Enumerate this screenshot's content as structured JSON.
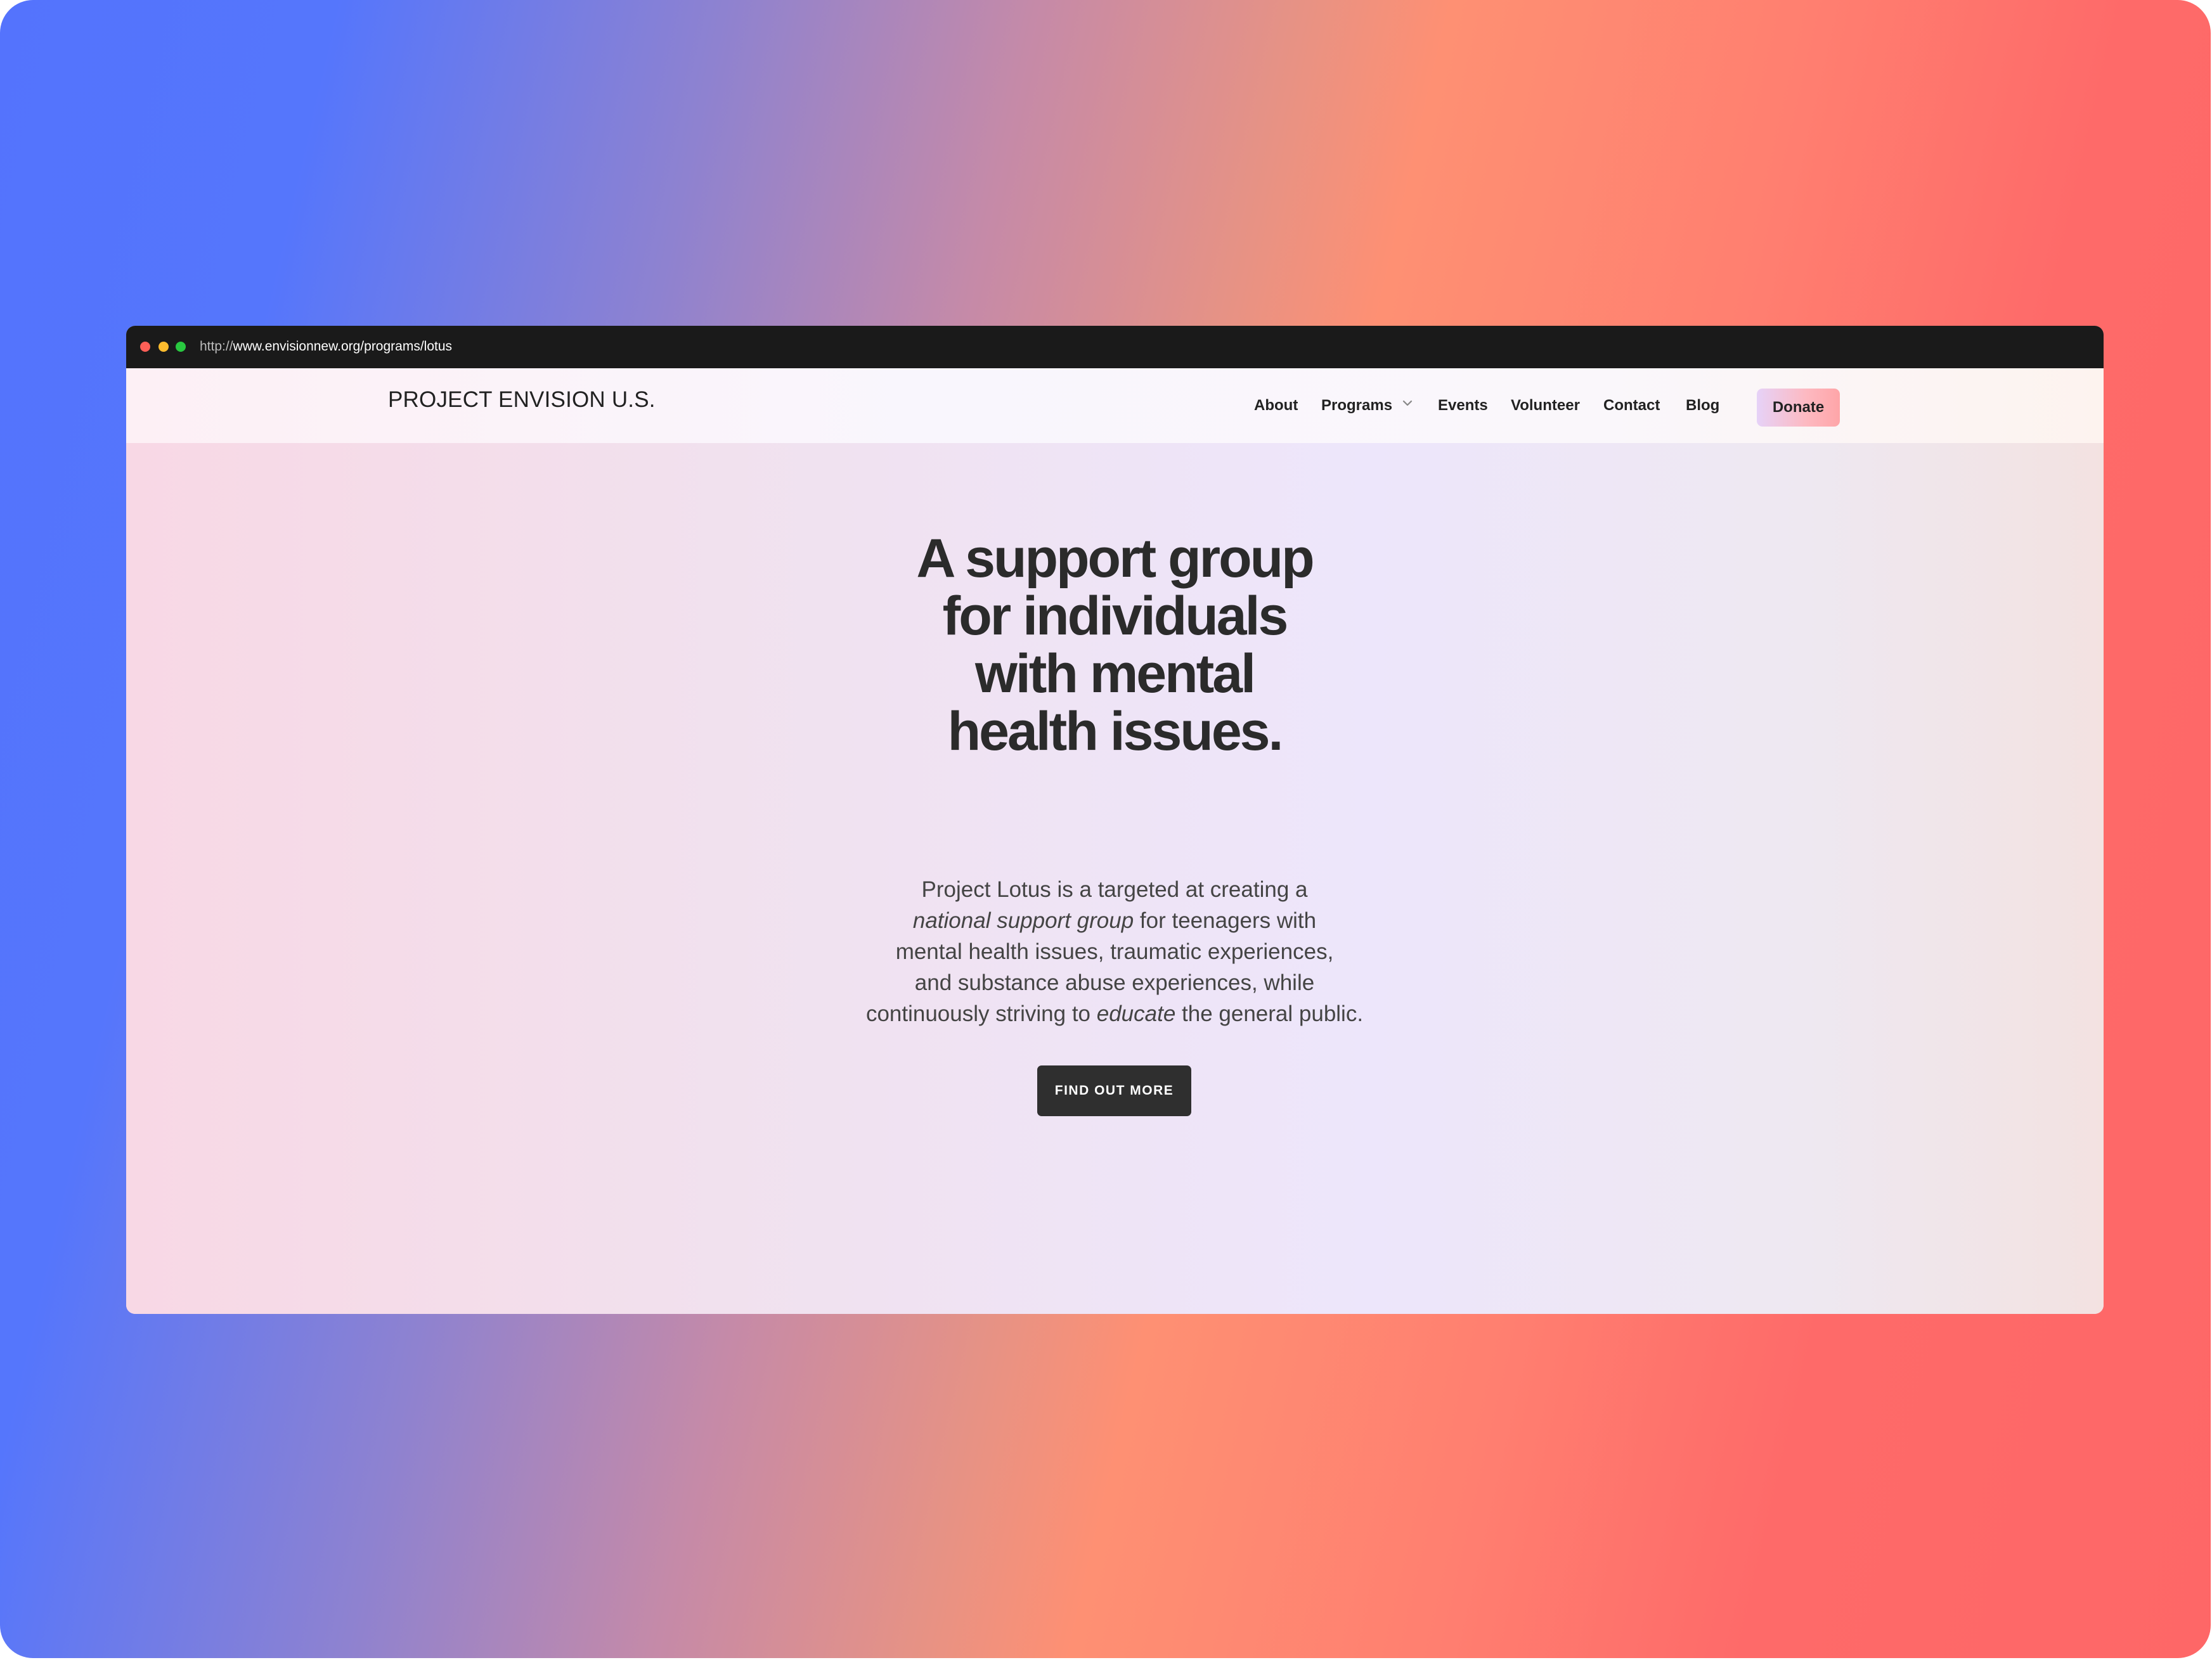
{
  "browser": {
    "url_protocol": "http://",
    "url_path": "www.envisionnew.org/programs/lotus"
  },
  "site": {
    "logo": "PROJECT ENVISION U.S."
  },
  "nav": {
    "about": "About",
    "programs": "Programs",
    "events": "Events",
    "volunteer": "Volunteer",
    "contact": "Contact",
    "blog": "Blog",
    "donate": "Donate"
  },
  "hero": {
    "title_lines": [
      "A support group",
      "for individuals",
      "with mental",
      "health issues."
    ],
    "desc_line1": "Project Lotus is a targeted at creating a",
    "desc_line2_em": "national support group",
    "desc_line2_rest": " for teenagers with",
    "desc_line3": "mental health issues, traumatic experiences,",
    "desc_line4": "and substance abuse experiences, while",
    "desc_line5_start": "continuously striving to ",
    "desc_line5_em": "educate",
    "desc_line5_end": " the general public.",
    "cta": "FIND OUT MORE"
  },
  "colors": {
    "titlebar": "#1a1a1a",
    "text_dark": "#2b2b2b",
    "cta_bg": "#2f2f2f",
    "bg_blue": "#5473fd",
    "bg_coral": "#fe6767"
  },
  "icons": {
    "programs_dropdown": "chevron-down-icon"
  }
}
